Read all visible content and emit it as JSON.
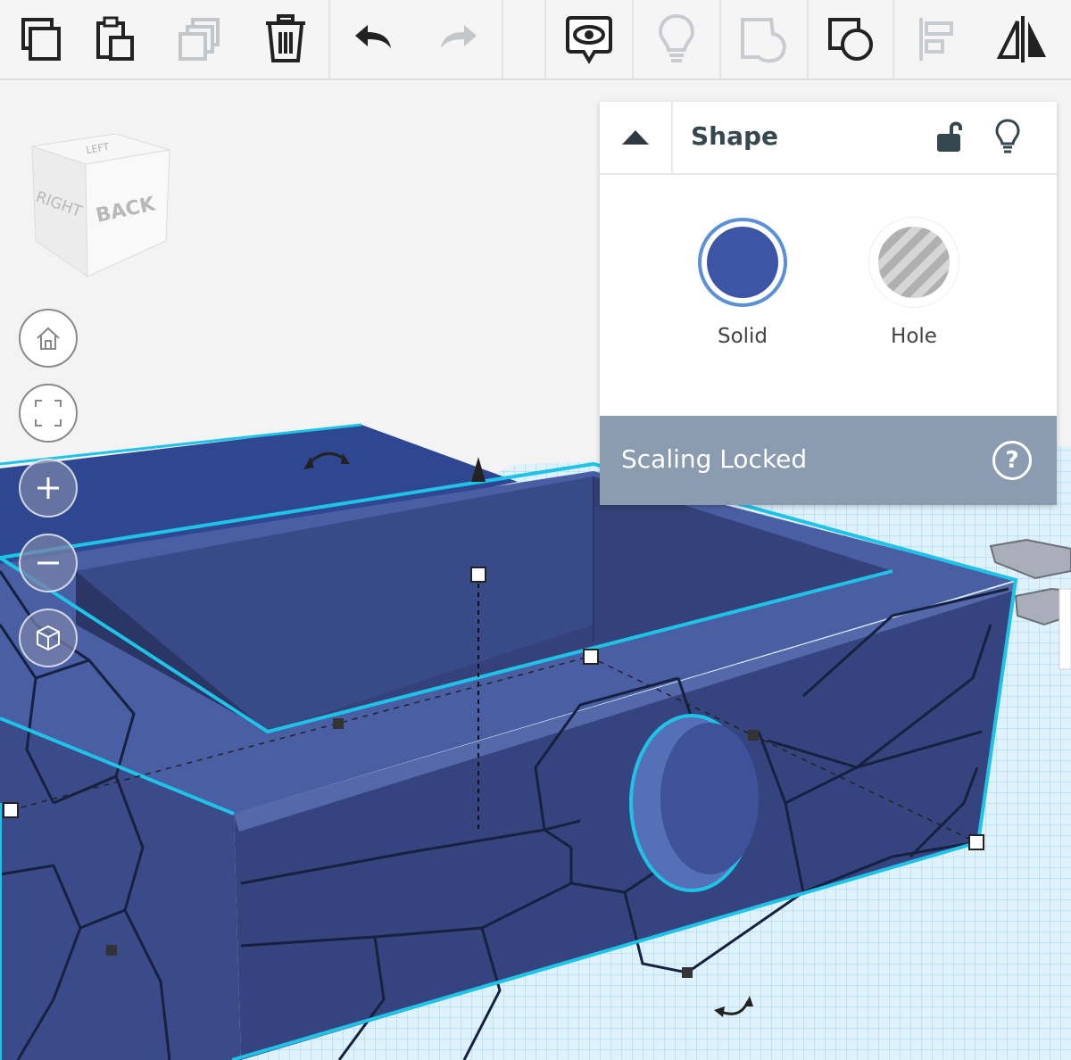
{
  "toolbar": {
    "buttons": [
      {
        "name": "copy",
        "icon": "copy-icon"
      },
      {
        "name": "paste",
        "icon": "paste-icon"
      },
      {
        "name": "duplicate",
        "icon": "duplicate-icon"
      },
      {
        "name": "delete",
        "icon": "trash-icon"
      },
      {
        "name": "undo",
        "icon": "undo-icon"
      },
      {
        "name": "redo",
        "icon": "redo-icon"
      },
      {
        "name": "notes",
        "icon": "eye-note-icon"
      },
      {
        "name": "hints",
        "icon": "lightbulb-icon"
      },
      {
        "name": "group",
        "icon": "group-icon"
      },
      {
        "name": "ungroup",
        "icon": "ungroup-icon"
      },
      {
        "name": "align",
        "icon": "align-icon"
      },
      {
        "name": "mirror",
        "icon": "mirror-icon"
      }
    ]
  },
  "viewcube": {
    "right": "RIGHT",
    "back": "BACK",
    "top": "LEFT"
  },
  "nav": {
    "buttons": [
      {
        "name": "home-view",
        "icon": "home-icon"
      },
      {
        "name": "fit-view",
        "icon": "fit-frame-icon"
      },
      {
        "name": "zoom-in",
        "icon": "plus-icon"
      },
      {
        "name": "zoom-out",
        "icon": "minus-icon"
      },
      {
        "name": "projection",
        "icon": "perspective-cube-icon"
      }
    ]
  },
  "shape_panel": {
    "title": "Shape",
    "solid_label": "Solid",
    "hole_label": "Hole",
    "solid_color": "#3c55a5",
    "scaling_text": "Scaling Locked",
    "help_symbol": "?"
  },
  "colors": {
    "accent": "#1fc3e8",
    "shape": "#3c4f8f",
    "grid": "#bfe3f5"
  }
}
